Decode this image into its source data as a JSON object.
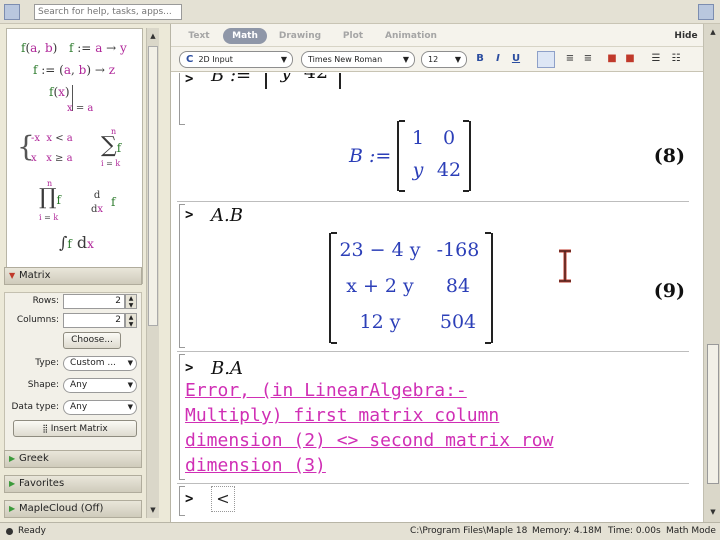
{
  "search": {
    "placeholder": "Search for help, tasks, apps..."
  },
  "palette": {
    "expressions": [
      "f(a, b)",
      "f := a → y",
      "f := (a, b) → z",
      "f(x)",
      "x = a",
      "-x  x < a",
      "x  x ≥ a",
      "∑f",
      "∏f",
      "d/dx f",
      "∫f dx"
    ],
    "sum_limits": {
      "upper": "n",
      "lower": "i = k"
    },
    "prod_limits": {
      "upper": "n",
      "lower": "i = k"
    }
  },
  "matrix_panel": {
    "header": "Matrix",
    "rows_label": "Rows:",
    "rows_value": "2",
    "columns_label": "Columns:",
    "columns_value": "2",
    "choose_label": "Choose...",
    "type_label": "Type:",
    "type_value": "Custom ...",
    "shape_label": "Shape:",
    "shape_value": "Any",
    "datatype_label": "Data type:",
    "datatype_value": "Any",
    "insert_label": "Insert Matrix"
  },
  "sections": [
    {
      "label": "Greek"
    },
    {
      "label": "Favorites"
    },
    {
      "label": "MapleCloud (Off)"
    }
  ],
  "tabs": [
    "Text",
    "Math",
    "Drawing",
    "Plot",
    "Animation"
  ],
  "active_tab": "Math",
  "hide_label": "Hide",
  "toolbar": {
    "input_mode_icon": "C",
    "input_mode": "2D Input",
    "font": "Times New Roman",
    "size": "12",
    "bold": "B",
    "italic": "I",
    "underline": "U"
  },
  "document": {
    "prompt": ">",
    "partial_matrix": {
      "name": "B :=",
      "row": [
        "y",
        "42"
      ]
    },
    "output_b": {
      "name": "B :=",
      "rows": [
        [
          "1",
          "0"
        ],
        [
          "y",
          "42"
        ]
      ],
      "label": "(8)"
    },
    "input_ab": "A.B",
    "output_ab": {
      "rows": [
        [
          "23 − 4 y",
          "-168"
        ],
        [
          "x + 2 y",
          "84"
        ],
        [
          "12 y",
          "504"
        ]
      ],
      "label": "(9)"
    },
    "input_ba": "B.A",
    "error_lines": [
      "Error, (in LinearAlgebra:-",
      "Multiply) first matrix column",
      "dimension (2) <> second matrix row",
      "dimension (3)"
    ],
    "empty_input": "<"
  },
  "status": {
    "state": "Ready",
    "path": "C:\\Program Files\\Maple 18",
    "memory": "Memory: 4.18M",
    "time": "Time: 0.00s",
    "mode": "Math Mode"
  }
}
